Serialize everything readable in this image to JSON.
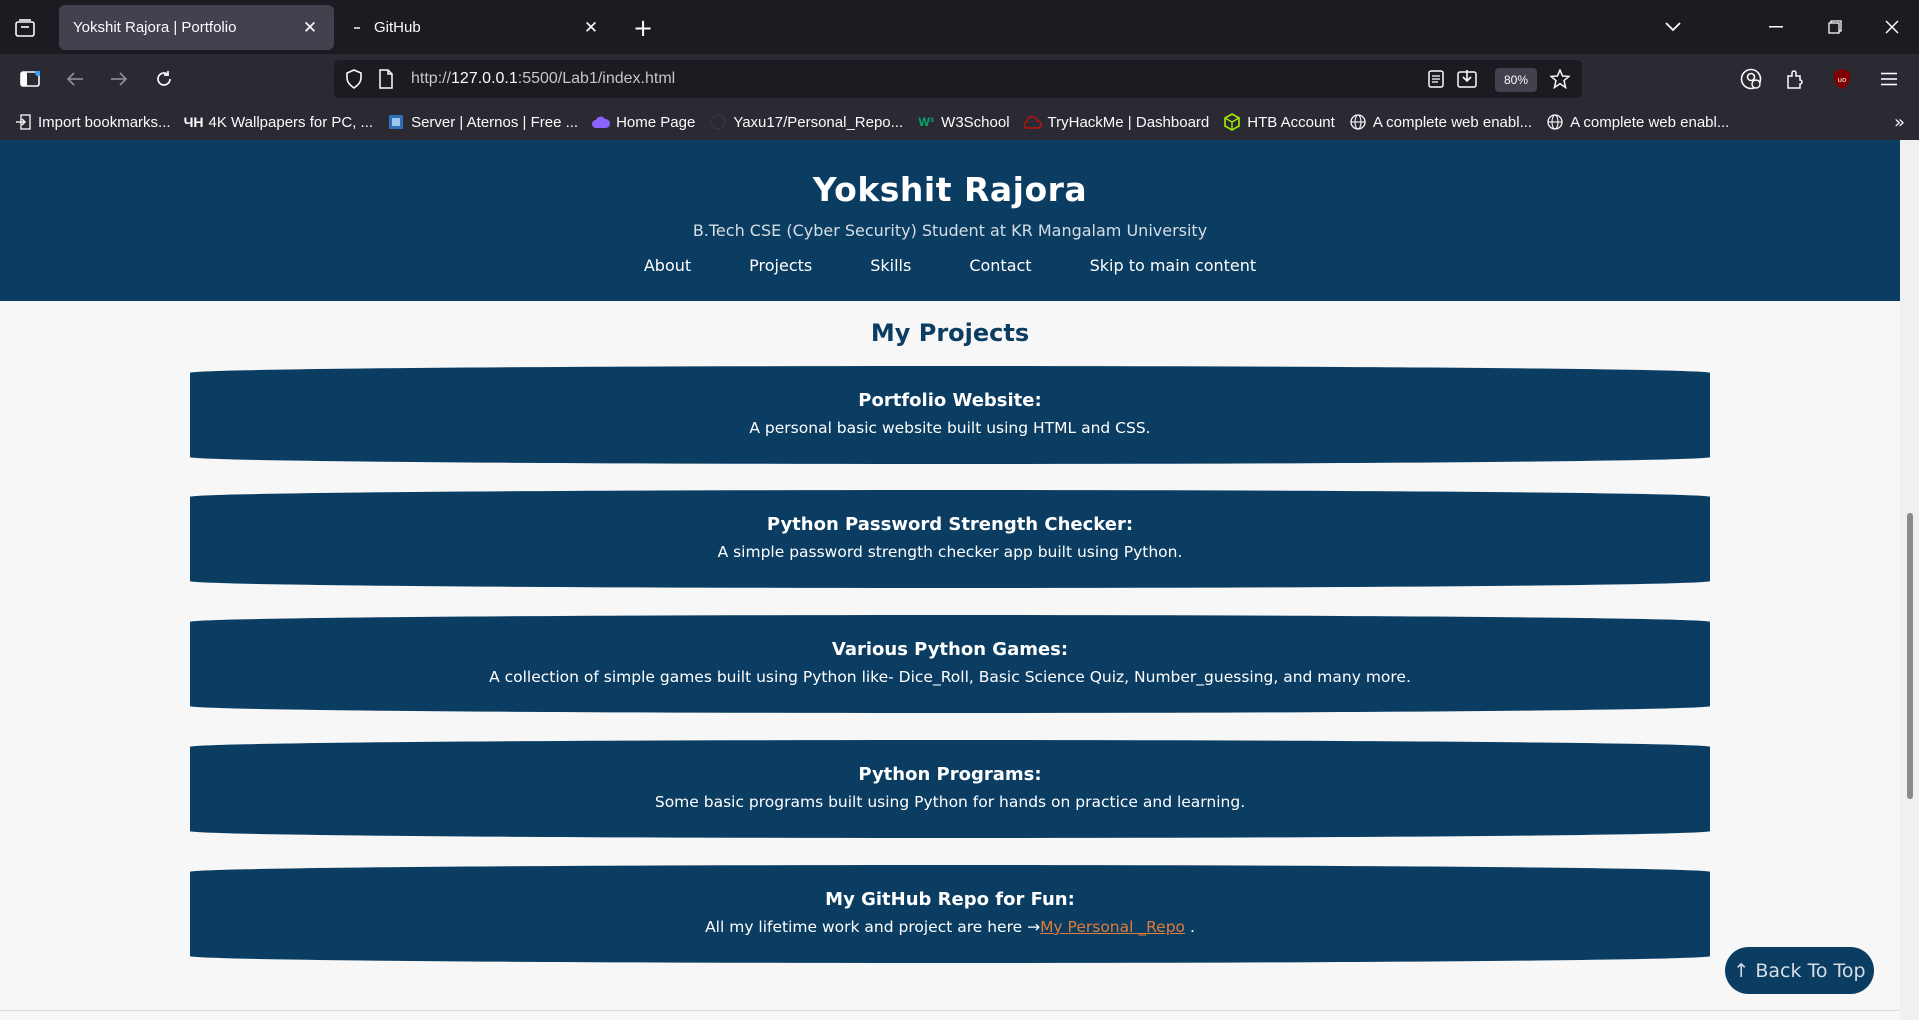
{
  "browser": {
    "tabs": [
      {
        "title": "Yokshit Rajora | Portfolio",
        "active": true
      },
      {
        "title": "GitHub",
        "active": false
      }
    ],
    "url": {
      "prefix": "http://",
      "host": "127.0.0.1",
      "rest": ":5500/Lab1/index.html"
    },
    "zoom": "80%",
    "bookmarks": [
      {
        "label": "Import bookmarks...",
        "icon": "import-icon"
      },
      {
        "label": "4K Wallpapers for PC, ...",
        "icon": "wallpaper-site-icon"
      },
      {
        "label": "Server | Aternos | Free ...",
        "icon": "aternos-icon"
      },
      {
        "label": "Home Page",
        "icon": "cloud-icon"
      },
      {
        "label": "Yaxu17/Personal_Repo...",
        "icon": "github-icon"
      },
      {
        "label": "W3School",
        "icon": "w3school-icon"
      },
      {
        "label": "TryHackMe | Dashboard",
        "icon": "tryhackme-icon"
      },
      {
        "label": "HTB Account",
        "icon": "htb-icon"
      },
      {
        "label": "A complete web enabl...",
        "icon": "globe-icon"
      },
      {
        "label": "A complete web enabl...",
        "icon": "globe-icon"
      }
    ]
  },
  "site": {
    "name": "Yokshit Rajora",
    "subtitle": "B.Tech CSE (Cyber Security) Student at KR Mangalam University",
    "nav": [
      "About",
      "Projects",
      "Skills",
      "Contact",
      "Skip to main content"
    ],
    "section_title": "My Projects",
    "projects": [
      {
        "title": "Portfolio Website:",
        "desc": "A personal basic website built using HTML and CSS."
      },
      {
        "title": "Python Password Strength Checker:",
        "desc": "A simple password strength checker app built using Python."
      },
      {
        "title": "Various Python Games:",
        "desc": "A collection of simple games built using Python like- Dice_Roll, Basic Science Quiz, Number_guessing, and many more."
      },
      {
        "title": "Python Programs:",
        "desc": "Some basic programs built using Python for hands on practice and learning."
      },
      {
        "title": "My GitHub Repo for Fun:",
        "desc_prefix": "All my lifetime work and project are here →",
        "link": "My Personal _Repo",
        "desc_suffix": " ."
      }
    ],
    "back_to_top": "↑ Back To Top"
  },
  "colors": {
    "header_bg": "#0b3d63",
    "link": "#e07b39",
    "page_bg": "#f7f7f7"
  }
}
